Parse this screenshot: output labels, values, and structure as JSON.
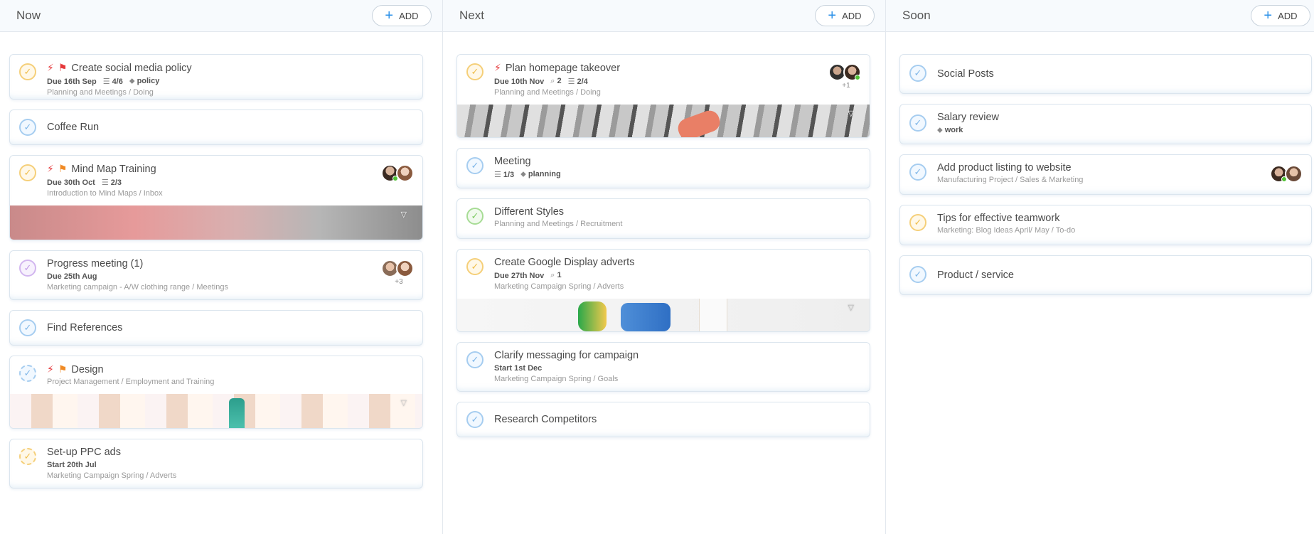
{
  "columns": [
    {
      "title": "Now",
      "add_label": "ADD",
      "cards": [
        {
          "title": "Create social media policy",
          "due": "Due 16th Sep",
          "checklist": "4/6",
          "tag": "policy",
          "path": "Planning and Meetings / Doing"
        },
        {
          "title": "Coffee Run"
        },
        {
          "title": "Mind Map Training",
          "due": "Due 30th Oct",
          "checklist": "2/3",
          "path": "Introduction to Mind Maps / Inbox"
        },
        {
          "title": "Progress meeting (1)",
          "due": "Due 25th Aug",
          "path": "Marketing campaign - A/W clothing range / Meetings",
          "more": "+3"
        },
        {
          "title": "Find References"
        },
        {
          "title": "Design",
          "path": "Project Management / Employment and Training"
        },
        {
          "title": "Set-up PPC ads",
          "start": "Start 20th Jul",
          "path": "Marketing Campaign Spring / Adverts"
        }
      ]
    },
    {
      "title": "Next",
      "add_label": "ADD",
      "cards": [
        {
          "title": "Plan homepage takeover",
          "due": "Due 10th Nov",
          "attachments": "2",
          "checklist": "2/4",
          "path": "Planning and Meetings / Doing",
          "more": "+1"
        },
        {
          "title": "Meeting",
          "checklist": "1/3",
          "tag": "planning"
        },
        {
          "title": "Different Styles",
          "path": "Planning and Meetings / Recruitment"
        },
        {
          "title": "Create Google Display adverts",
          "due": "Due 27th Nov",
          "attachments": "1",
          "path": "Marketing Campaign Spring / Adverts"
        },
        {
          "title": "Clarify messaging for campaign",
          "start": "Start 1st Dec",
          "path": "Marketing Campaign Spring / Goals"
        },
        {
          "title": "Research Competitors"
        }
      ]
    },
    {
      "title": "Soon",
      "add_label": "ADD",
      "cards": [
        {
          "title": "Social Posts"
        },
        {
          "title": "Salary review",
          "tag": "work"
        },
        {
          "title": "Add product listing to website",
          "path": "Manufacturing Project / Sales & Marketing"
        },
        {
          "title": "Tips for effective teamwork",
          "path": "Marketing: Blog Ideas April/ May / To-do"
        },
        {
          "title": "Product / service"
        }
      ]
    }
  ],
  "icons": {
    "check": "✓",
    "priority": "⚡",
    "flag": "⚑",
    "checklist": "☰",
    "tag": "⬥",
    "attachment": "🔗",
    "caret": "▽",
    "plus": "+"
  },
  "colors": {
    "accent": "#2a90e8",
    "priority_red": "#e5383b",
    "flag_orange": "#f08a24",
    "online_green": "#50c234",
    "check_blue": "#a6cdf0",
    "check_yellow": "#f5cf79",
    "check_purple": "#d2b6ef",
    "check_green": "#a7dc95"
  }
}
